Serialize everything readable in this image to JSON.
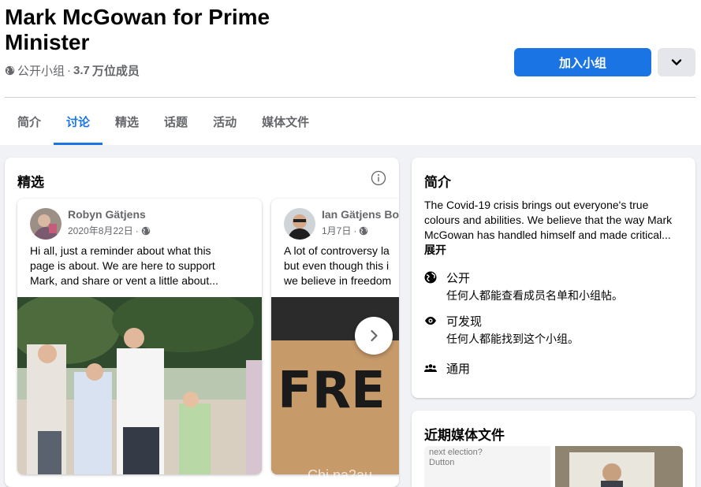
{
  "group": {
    "title": "Mark McGowan for Prime Minister",
    "privacy": "公开小组",
    "separator": "·",
    "members_count": "3.7",
    "members_unit": "万位成员",
    "join_label": "加入小组"
  },
  "tabs": [
    "简介",
    "讨论",
    "精选",
    "话题",
    "活动",
    "媒体文件"
  ],
  "active_tab": "讨论",
  "featured": {
    "heading": "精选",
    "posts": [
      {
        "author": "Robyn Gätjens",
        "date": "2020年8月22日",
        "dot": "·",
        "lines": [
          "Hi all, just a reminder about what this",
          "page is about. We are here to support",
          "Mark, and share or vent a little about..."
        ]
      },
      {
        "author": "Ian Gätjens Bo",
        "date": "1月7日",
        "dot": "·",
        "lines": [
          "A lot of controversy la",
          "but even though this i",
          "we believe in freedom"
        ]
      }
    ],
    "sign_text": "FRE SPEE",
    "watermark": "Chi na2au"
  },
  "about": {
    "heading": "简介",
    "description": "The Covid-19 crisis brings out everyone's true colours and abilities. We believe that the way Mark McGowan has handled himself and made critical...",
    "expand_label": "展开",
    "public_label": "公开",
    "public_desc": "任何人都能查看成员名单和小组帖。",
    "visible_label": "可发现",
    "visible_desc": "任何人都能找到这个小组。",
    "general_label": "通用"
  },
  "media": {
    "heading": "近期媒体文件",
    "thumb_lines": [
      "next election?",
      "Dutton"
    ]
  },
  "icons": [
    "globe-icon",
    "chevron-down-icon",
    "info-icon",
    "chevron-right-icon",
    "eye-icon",
    "people-icon"
  ],
  "colors": {
    "accent": "#1b74e4",
    "background": "#f0f2f5",
    "secondary_text": "#65676b"
  }
}
